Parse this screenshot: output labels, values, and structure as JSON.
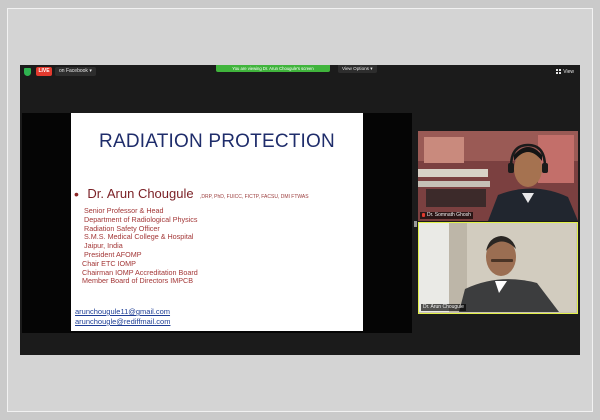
{
  "toolbar": {
    "live_label": "LIVE",
    "facebook_label": "on Facebook",
    "viewing_banner": "You are viewing Dr. Arun Chougule's screen",
    "view_options_label": "View Options",
    "view_label": "View"
  },
  "slide": {
    "title": "RADIATION PROTECTION",
    "presenter_name": "Dr. Arun Chougule",
    "presenter_credentials": ",DRP, PhD, FUICC, FICTP, FACSU, DMI  FTWAS",
    "lines": [
      "Senior  Professor & Head",
      "Department of Radiological Physics",
      "Radiation Safety Officer",
      "S.M.S. Medical College & Hospital",
      "Jaipur, India",
      "President AFOMP",
      "Chair ETC IOMP",
      "Chairman IOMP Accreditation Board",
      "Member Board of Directors IMPCB"
    ],
    "emails": [
      "arunchougule11@gmail.com",
      "arunchougle@rediffmail.com"
    ]
  },
  "participants": [
    {
      "name": "Dr. Somnath Ghosh",
      "muted": true
    },
    {
      "name": "Dr. Arun Chougule",
      "muted": false
    }
  ],
  "colors": {
    "live_red": "#e23a2e",
    "banner_green": "#40b43c",
    "active_speaker_border": "#e2f14a",
    "slide_title_blue": "#1f2d6b",
    "slide_text_red": "#a33737"
  }
}
